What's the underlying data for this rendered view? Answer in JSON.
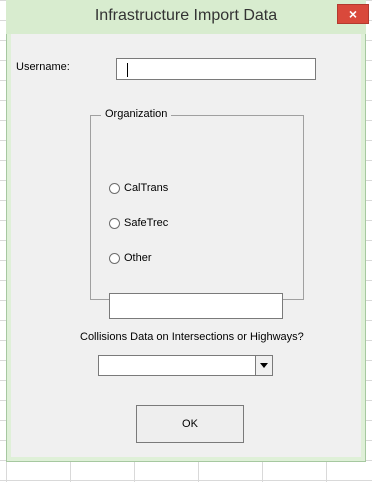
{
  "window": {
    "title": "Infrastructure Import Data",
    "close_icon": "×"
  },
  "form": {
    "username_label": "Username:",
    "username_value": "",
    "organization": {
      "legend": "Organization",
      "options": [
        "CalTrans",
        "SafeTrec",
        "Other"
      ],
      "selected": null,
      "other_value": ""
    },
    "collisions_label": "Collisions Data on Intersections or Highways?",
    "collisions_selected": "",
    "ok_label": "OK"
  },
  "colors": {
    "titlebar": "#d8eccf",
    "close_button": "#d9493b",
    "dialog_background": "#f0f0f0"
  }
}
